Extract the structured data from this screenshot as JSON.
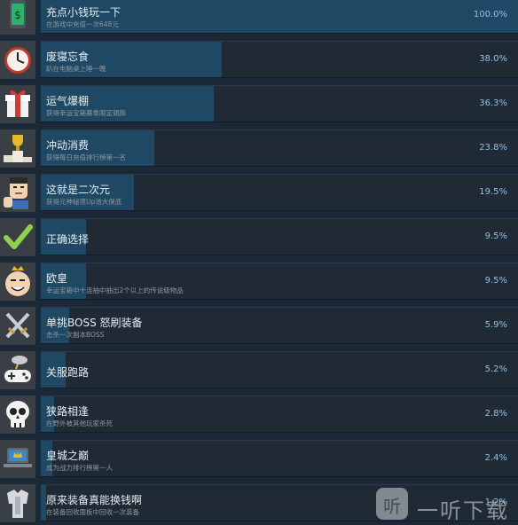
{
  "achievements": [
    {
      "name": "充点小钱玩一下",
      "desc": "在游戏中充值一次648元",
      "percent_label": "100.0%",
      "percent": 100.0,
      "icon": "phone-money-icon"
    },
    {
      "name": "废寝忘食",
      "desc": "趴在电脑桌上睡一晚",
      "percent_label": "38.0%",
      "percent": 38.0,
      "icon": "alarm-clock-icon"
    },
    {
      "name": "运气爆棚",
      "desc": "获得幸运宝箱赛季限定頭飾",
      "percent_label": "36.3%",
      "percent": 36.3,
      "icon": "gift-box-icon"
    },
    {
      "name": "冲动消费",
      "desc": "获得每日充值排行榜第一名",
      "percent_label": "23.8%",
      "percent": 23.8,
      "icon": "trophy-podium-icon"
    },
    {
      "name": "这就是二次元",
      "desc": "获得元神秘境Up池大保底",
      "percent_label": "19.5%",
      "percent": 19.5,
      "icon": "thumbs-up-face-icon"
    },
    {
      "name": "正确选择",
      "desc": "",
      "percent_label": "9.5%",
      "percent": 9.5,
      "icon": "checkmark-icon"
    },
    {
      "name": "欧皇",
      "desc": "幸运宝箱中十连抽中抽出2个以上的传说级物品",
      "percent_label": "9.5%",
      "percent": 9.5,
      "icon": "crowned-face-icon"
    },
    {
      "name": "单挑BOSS 怒刷装备",
      "desc": "击杀一次副本BOSS",
      "percent_label": "5.9%",
      "percent": 5.9,
      "icon": "crossed-swords-icon"
    },
    {
      "name": "关服跑路",
      "desc": "",
      "percent_label": "5.2%",
      "percent": 5.2,
      "icon": "gamepad-cloud-icon"
    },
    {
      "name": "狭路相逢",
      "desc": "在野外被其他玩家杀死",
      "percent_label": "2.8%",
      "percent": 2.8,
      "icon": "skull-icon"
    },
    {
      "name": "皇城之巅",
      "desc": "成为战力排行榜第一人",
      "percent_label": "2.4%",
      "percent": 2.4,
      "icon": "laptop-crown-icon"
    },
    {
      "name": "原来装备真能换钱啊",
      "desc": "在装备回收面板中回收一次装备",
      "percent_label": "1.2%",
      "percent": 1.2,
      "icon": "armor-icon"
    }
  ],
  "watermark": {
    "logo_char": "听",
    "text": "一听下载"
  },
  "colors": {
    "background": "#1b2838",
    "panel": "#1f2a35",
    "bar": "#1e4863",
    "percent_text": "#8fc0e4"
  }
}
